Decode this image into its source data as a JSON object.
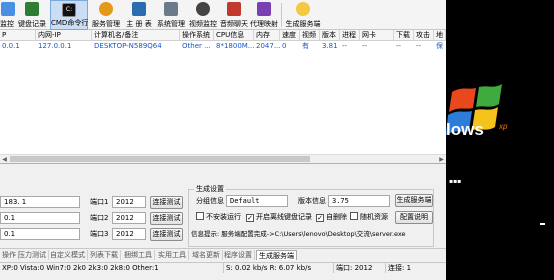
{
  "toolbar": {
    "items": [
      {
        "label": "监控",
        "color": "#4a90e2"
      },
      {
        "label": "键盘记录",
        "color": "#2f7d32"
      },
      {
        "label": "CMD命令行",
        "color": "#111111"
      },
      {
        "label": "服务管理",
        "color": "#e39a1b"
      },
      {
        "label": "主 册 表",
        "color": "#2b6cb0"
      },
      {
        "label": "系统管理",
        "color": "#6b7b8c"
      },
      {
        "label": "视频监控",
        "color": "#444444"
      },
      {
        "label": "音频聊天",
        "color": "#c0392b"
      },
      {
        "label": "代理映射",
        "color": "#7a3fb1"
      },
      {
        "label": "生成服务端",
        "color": "#f5c842"
      }
    ],
    "active_index": 2
  },
  "grid": {
    "columns": [
      "P",
      "内网-IP",
      "计算机名/备注",
      "操作系统",
      "CPU信息",
      "内存",
      "速度",
      "视频",
      "版本",
      "进程",
      "网卡",
      "下载",
      "攻击",
      "地"
    ],
    "rows": [
      [
        "0.0.1",
        "127.0.0.1",
        "DESKTOP-N589Q64",
        "Other ...",
        "8*1800M...",
        "2047...",
        "0",
        "有",
        "3.81",
        "--",
        "--",
        "--",
        "--",
        "保"
      ]
    ]
  },
  "connection": {
    "hosts": [
      "183. 1",
      "0.1",
      "0.1"
    ],
    "port_label1": "端口1",
    "port_label2": "端口2",
    "port_label3": "端口3",
    "ports": [
      "2012",
      "2012",
      "2012"
    ],
    "test_button": "连接测试"
  },
  "build": {
    "group_title": "生成设置",
    "group_label": "分组信息",
    "group_value": "Default",
    "version_label": "版本信息",
    "version_value": "3.75",
    "build_button": "生成服务端",
    "config_button": "配置说明",
    "checkbox_no_install": "不安装运行",
    "checkbox_keylog": "开启离线键盘记录",
    "checkbox_self_delete": "自删除",
    "checkbox_random": "随机资源",
    "info_text": "信息提示: 服务端配置完成->C:\\Users\\lenovo\\Desktop\\交流\\server.exe"
  },
  "tabs": {
    "items": [
      "操作",
      "压力测试",
      "自定义模式",
      "列表下载",
      "捆绑工具",
      "实用工具",
      "域名更新",
      "程序设置",
      "生成服务端"
    ],
    "active_index": 8
  },
  "status": {
    "os_counts": "XP:0  Vista:0  Win7:0  2k0  2k3:0  2k8:0  Other:1",
    "speed": "S: 0.02 kb/s R: 6.07 kb/s",
    "port": "端口: 2012",
    "connections": "连接: 1"
  },
  "desktop": {
    "logo_text": "lows",
    "logo_suffix": "xp"
  }
}
